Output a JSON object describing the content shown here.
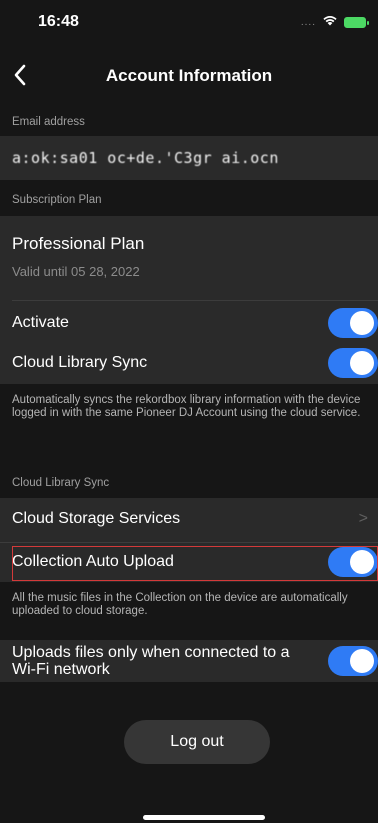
{
  "status_bar": {
    "time": "16:48",
    "signal_text": "....",
    "icons": [
      "wifi-icon",
      "battery-charging-icon"
    ],
    "battery_color": "#4cd964"
  },
  "nav": {
    "title": "Account Information",
    "back_icon": "chevron-left-icon"
  },
  "email_section": {
    "header": "Email address",
    "value": "a:ok:sa01 oc+de.'C3gr ai.ocn"
  },
  "subscription_section": {
    "header": "Subscription Plan",
    "plan_name": "Professional Plan",
    "valid_until": "Valid until 05 28, 2022",
    "activate_label": "Activate",
    "activate_on": true,
    "cloud_sync_label": "Cloud Library Sync",
    "cloud_sync_on": true,
    "cloud_sync_footnote": "Automatically syncs the rekordbox library information with the device logged in with the same Pioneer DJ Account using the cloud service."
  },
  "cloud_section": {
    "header": "Cloud Library Sync",
    "storage_label": "Cloud Storage Services",
    "storage_chevron": ">",
    "auto_upload_label": "Collection Auto Upload",
    "auto_upload_on": true,
    "auto_upload_footnote": "All the music files in the Collection on the device are automatically uploaded to cloud storage.",
    "wifi_only_label": "Uploads files only when connected to a Wi-Fi network",
    "wifi_only_on": true
  },
  "logout_label": "Log out",
  "colors": {
    "background": "#161616",
    "cell": "#2a2a2a",
    "toggle_on": "#2f7bf5",
    "highlight": "#d33a3a"
  }
}
